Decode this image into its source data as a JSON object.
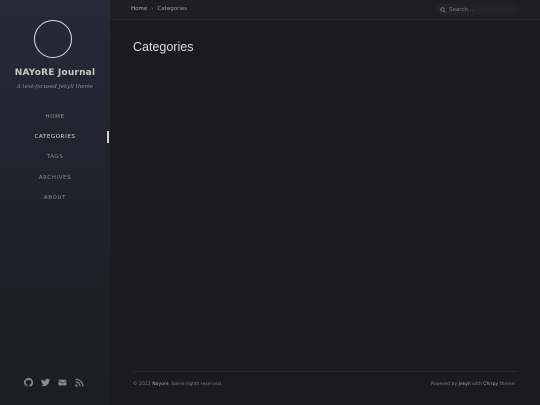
{
  "sidebar": {
    "site_title": "NAYoRE Journal",
    "site_subtitle": "A text-focused Jekyll theme",
    "nav": [
      {
        "label": "HOME",
        "active": false
      },
      {
        "label": "CATEGORIES",
        "active": true
      },
      {
        "label": "TAGS",
        "active": false
      },
      {
        "label": "ARCHIVES",
        "active": false
      },
      {
        "label": "ABOUT",
        "active": false
      }
    ],
    "social_icons": [
      "github-icon",
      "twitter-icon",
      "email-icon",
      "rss-icon"
    ]
  },
  "topbar": {
    "breadcrumb": {
      "home": "Home",
      "separator": "›",
      "current": "Categories"
    },
    "search": {
      "placeholder": "Search..."
    }
  },
  "main": {
    "title": "Categories"
  },
  "footer": {
    "copyright_prefix": "© 2022",
    "owner": "Nayore",
    "copyright_suffix": ". Some rights reserved.",
    "powered_prefix": "Powered by",
    "jekyll": "Jekyll",
    "with": "with",
    "chirpy": "Chirpy",
    "theme": "theme."
  },
  "colors": {
    "background": "#1b1b1e",
    "sidebar_top": "#262a37",
    "link": "#8fb3d9",
    "text": "#dcdcdc"
  }
}
